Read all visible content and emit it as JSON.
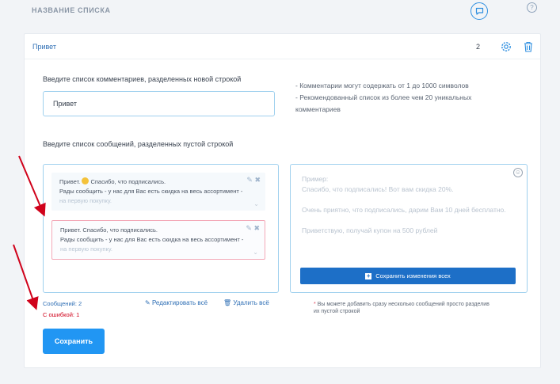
{
  "header": {
    "title": "НАЗВАНИЕ СПИСКА",
    "help_label": "?"
  },
  "list_card": {
    "title": "Привет",
    "count": "2",
    "comments_label": "Введите список комментариев, разделенных новой строкой",
    "comments_value": "Привет",
    "tips": [
      "- Комментарии могут содержать от 1 до 1000 символов",
      "- Рекомендованный список из более чем 20 уникальных комментариев"
    ],
    "messages_label": "Введите список сообщений, разделенных пустой строкой",
    "messages": [
      {
        "greeting": "Привет.",
        "line1_rest": "Спасибо, что подписались.",
        "line2": "Рады сообщить - у нас для Вас есть скидка на весь ассортимент -",
        "line3": "на первую покупку.",
        "has_error": false
      },
      {
        "greeting": "Привет.",
        "line1_rest": "Спасибо, что подписались.",
        "line2": "Рады сообщить - у нас для Вас есть скидка на весь ассортимент -",
        "line3": "на первую покупку.",
        "has_error": true
      }
    ],
    "example_text": "Пример:\nСпасибо, что подписались! Вот вам скидка 20%.\n\nОчень приятно, что подписались, дарим Вам 10 дней бесплатно.\n\nПриветствую, получай купон на 500 рублей",
    "save_all_label": "Сохранить изменения всех",
    "messages_count": "Сообщений: 2",
    "errors_count": "С ошибкой: 1",
    "edit_all_label": "Редактировать всё",
    "delete_all_label": "Удалить всё",
    "note_star": "*",
    "note": "Вы можете добавить сразу несколько сообщений просто разделив их пустой строкой",
    "save_label": "Сохранить"
  },
  "colors": {
    "accent": "#2196f3",
    "primary_button": "#1d6fc7",
    "error": "#d0021b",
    "annotation_arrow": "#d0021b"
  }
}
